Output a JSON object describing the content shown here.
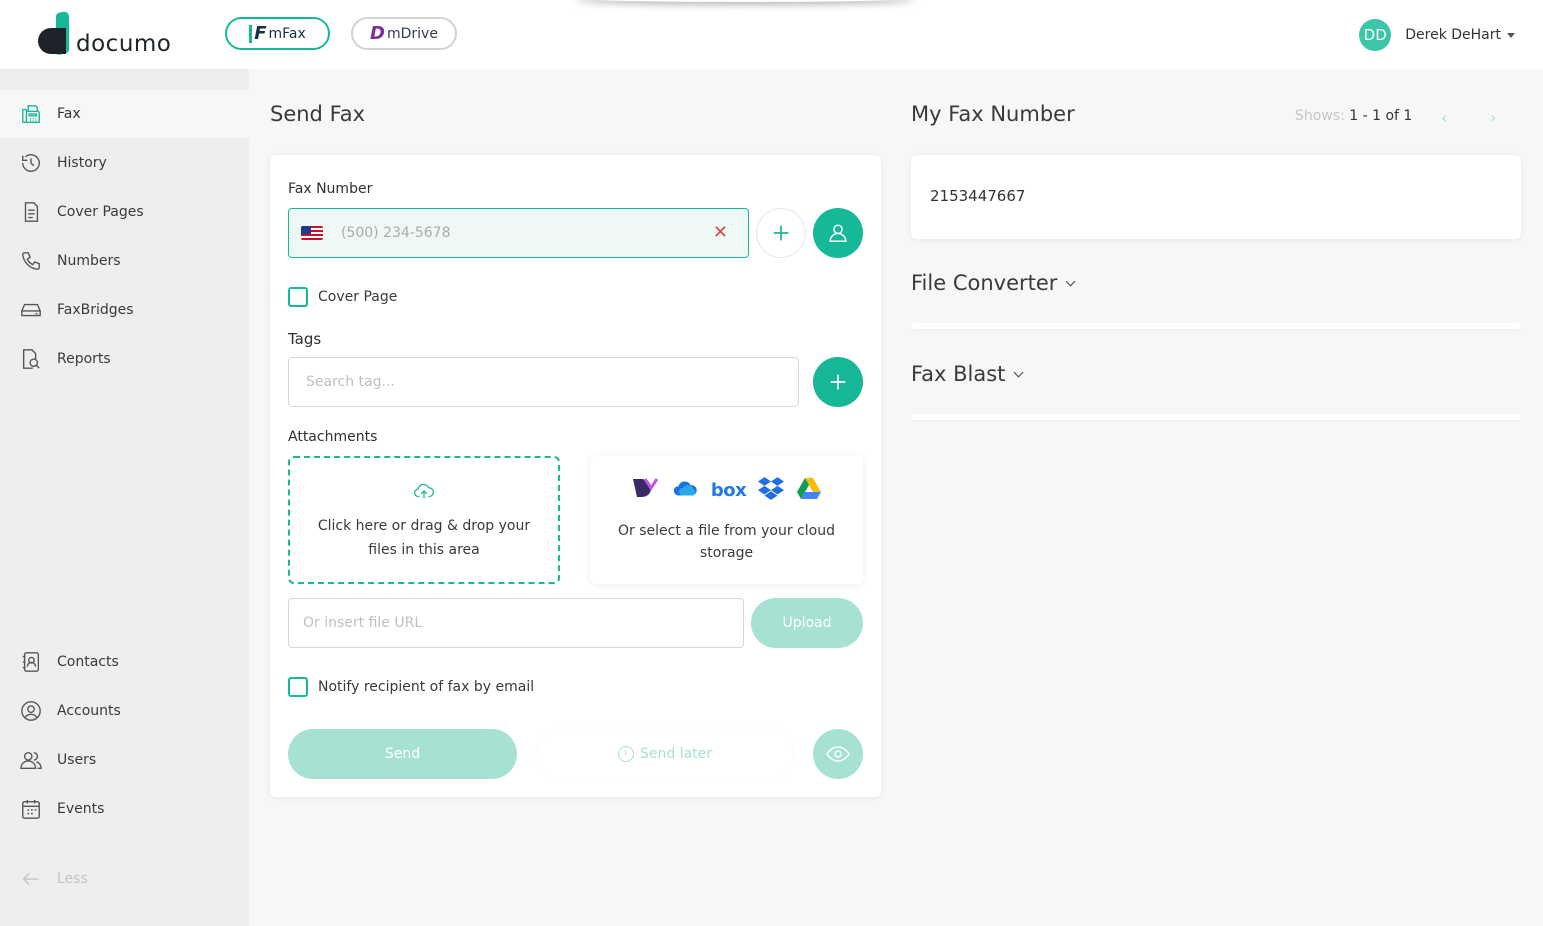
{
  "brand": {
    "name": "documo"
  },
  "apps": [
    {
      "label": "mFax",
      "glyph": "F"
    },
    {
      "label": "mDrive",
      "glyph": "D"
    }
  ],
  "user": {
    "initials": "DD",
    "name": "Derek DeHart"
  },
  "sidebar": {
    "items": [
      {
        "label": "Fax",
        "icon": "fax-icon"
      },
      {
        "label": "History",
        "icon": "history-icon"
      },
      {
        "label": "Cover Pages",
        "icon": "document-icon"
      },
      {
        "label": "Numbers",
        "icon": "phone-icon"
      },
      {
        "label": "FaxBridges",
        "icon": "drive-icon"
      },
      {
        "label": "Reports",
        "icon": "report-search-icon"
      }
    ],
    "bottom_items": [
      {
        "label": "Contacts",
        "icon": "contact-book-icon"
      },
      {
        "label": "Accounts",
        "icon": "account-icon"
      },
      {
        "label": "Users",
        "icon": "users-icon"
      },
      {
        "label": "Events",
        "icon": "calendar-icon"
      }
    ],
    "less_label": "Less"
  },
  "send_fax": {
    "title": "Send Fax",
    "fax_number_label": "Fax Number",
    "fax_number_placeholder": "(500) 234-5678",
    "cover_page_label": "Cover Page",
    "tags_label": "Tags",
    "tags_placeholder": "Search tag...",
    "attachments_label": "Attachments",
    "dropzone_text": "Click here or drag & drop your files in this area",
    "cloud_text": "Or select a file from your cloud storage",
    "cloud_box_word": "box",
    "url_placeholder": "Or insert file URL",
    "upload_label": "Upload",
    "notify_label": "Notify recipient of fax by email",
    "send_label": "Send",
    "send_later_label": "Send later"
  },
  "my_fax_number": {
    "title": "My Fax Number",
    "pager_label": "Shows:",
    "pager_range": "1 - 1 of 1",
    "number": "2153447667"
  },
  "file_converter": {
    "title": "File Converter"
  },
  "fax_blast": {
    "title": "Fax Blast"
  },
  "colors": {
    "accent": "#17b897",
    "accent_light": "#a6e1d3",
    "sidebar_bg": "#eeeeee"
  }
}
